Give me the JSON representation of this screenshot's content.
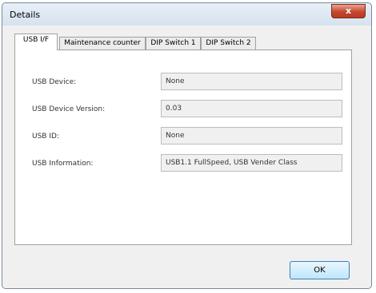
{
  "window": {
    "title": "Details",
    "close_glyph": "x"
  },
  "tabs": [
    {
      "label": "USB I/F",
      "active": true
    },
    {
      "label": "Maintenance counter",
      "active": false
    },
    {
      "label": "DIP Switch 1",
      "active": false
    },
    {
      "label": "DIP Switch 2",
      "active": false
    }
  ],
  "fields": [
    {
      "label": "USB Device:",
      "value": "None"
    },
    {
      "label": "USB Device Version:",
      "value": "0.03"
    },
    {
      "label": "USB ID:",
      "value": "None"
    },
    {
      "label": "USB Information:",
      "value": "USB1.1 FullSpeed,  USB Vender Class"
    }
  ],
  "buttons": {
    "ok_label": "OK"
  },
  "colors": {
    "close_button": "#c7462f",
    "ok_border": "#3c7fb1"
  }
}
